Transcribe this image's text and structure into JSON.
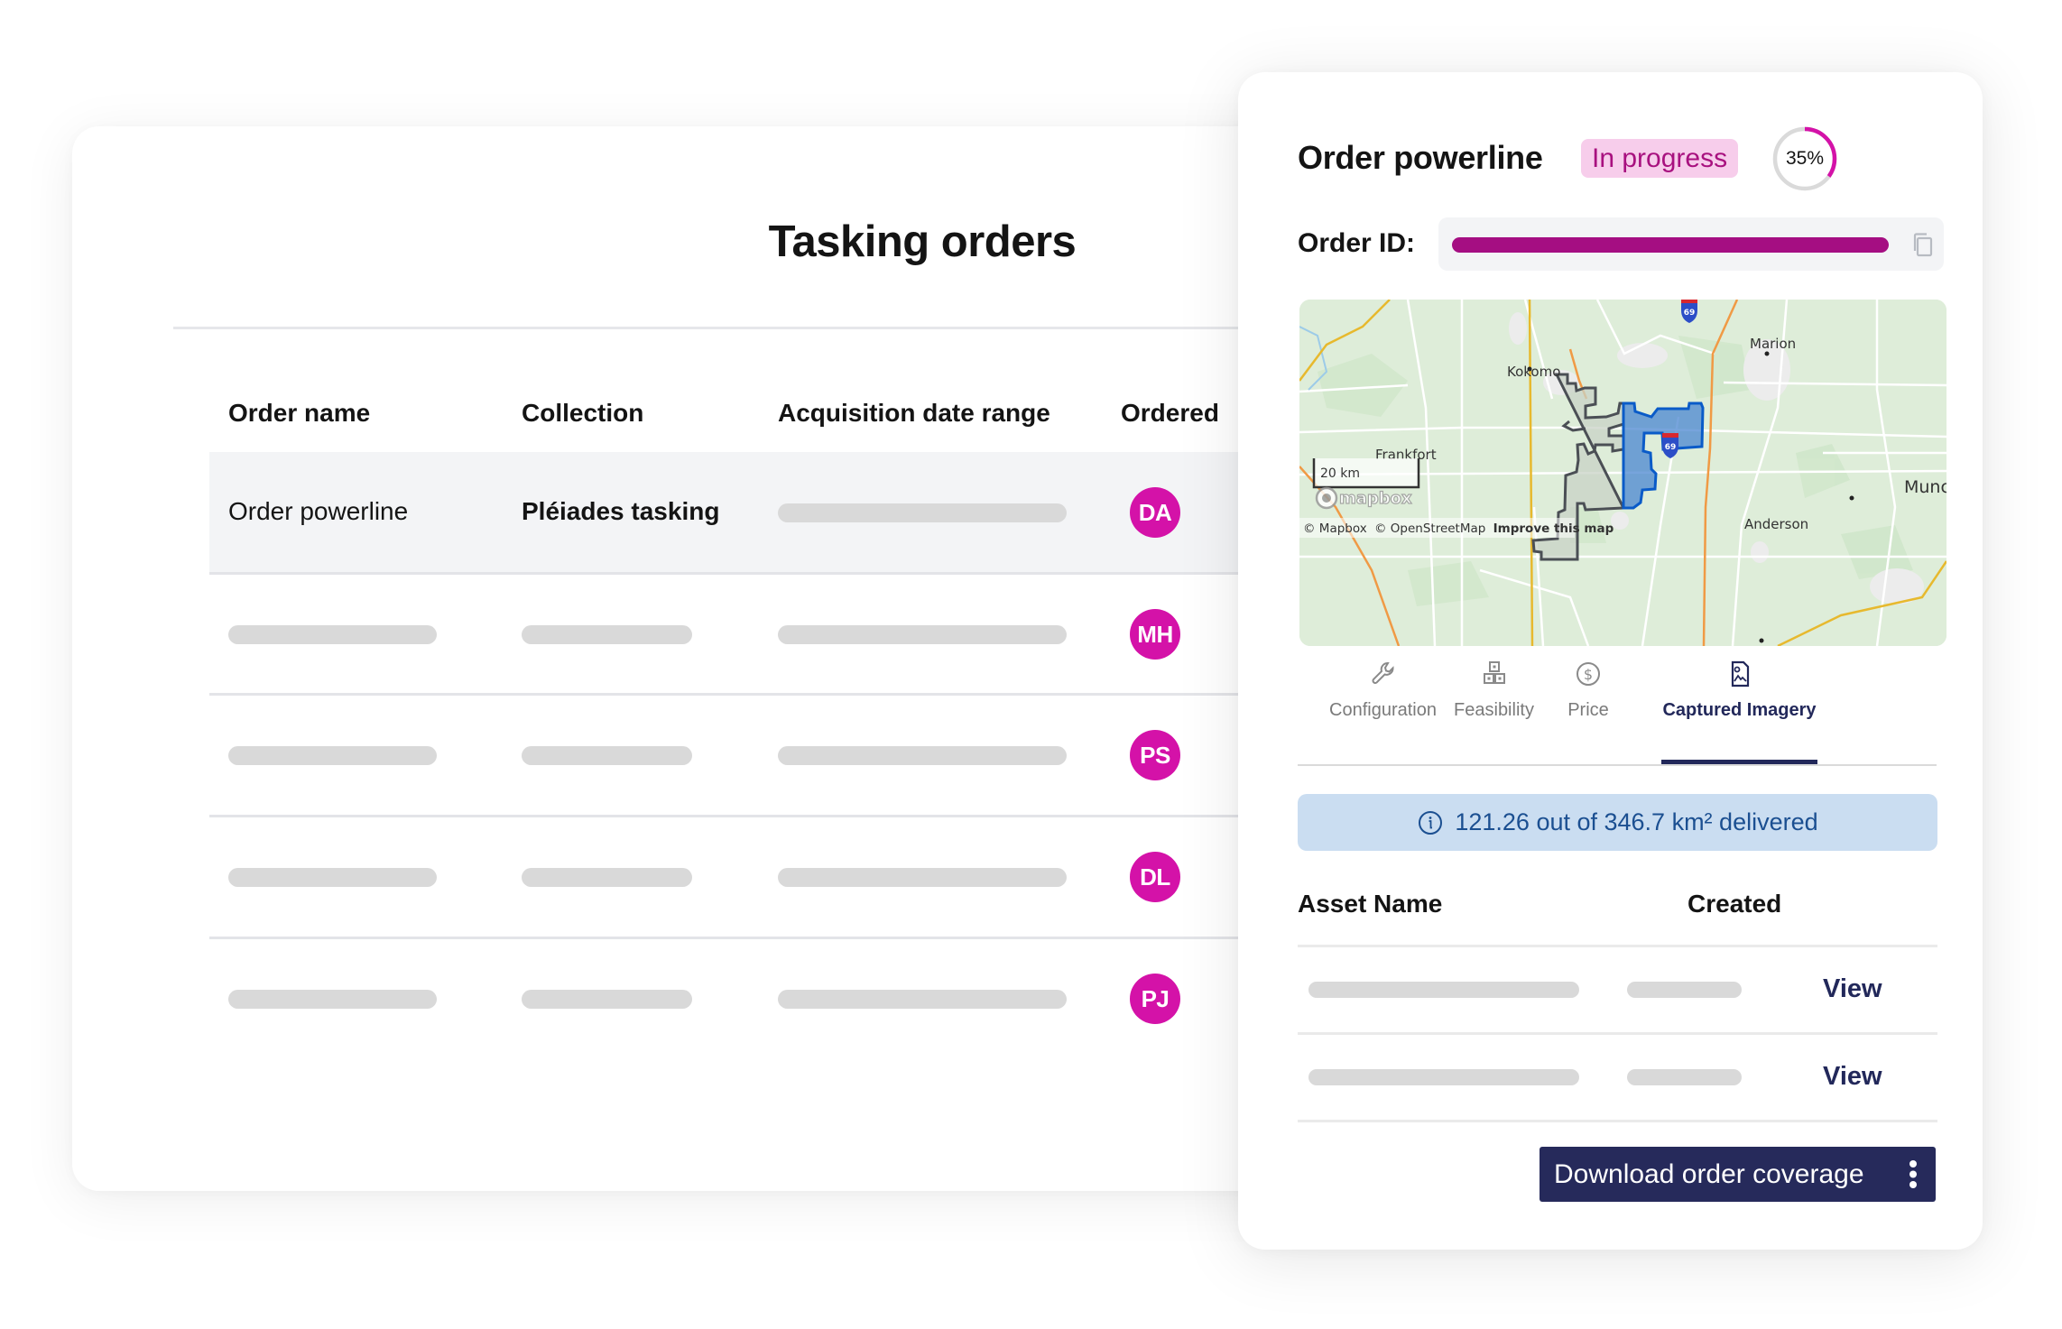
{
  "tasking_orders": {
    "title": "Tasking orders",
    "columns": [
      "Order name",
      "Collection",
      "Acquisition date range",
      "Ordered"
    ],
    "rows": [
      {
        "order_name": "Order powerline",
        "collection": "Pléiades tasking",
        "date_range": null,
        "ordered_by": "DA",
        "highlighted": true
      },
      {
        "order_name": null,
        "collection": null,
        "date_range": null,
        "ordered_by": "MH",
        "highlighted": false
      },
      {
        "order_name": null,
        "collection": null,
        "date_range": null,
        "ordered_by": "PS",
        "highlighted": false
      },
      {
        "order_name": null,
        "collection": null,
        "date_range": null,
        "ordered_by": "DL",
        "highlighted": false
      },
      {
        "order_name": null,
        "collection": null,
        "date_range": null,
        "ordered_by": "PJ",
        "highlighted": false
      }
    ]
  },
  "order_detail": {
    "title": "Order powerline",
    "status": "In progress",
    "progress_percent": 35,
    "progress_label": "35%",
    "order_id_label": "Order ID:",
    "order_id_value": null,
    "map": {
      "labels": [
        "Marion",
        "Kokomo",
        "Frankfort",
        "Muncie",
        "Anderson"
      ],
      "highway_shields": [
        "69",
        "69"
      ],
      "scale": "20 km",
      "logo": "mapbox",
      "attribution": [
        "© Mapbox",
        "© OpenStreetMap",
        "Improve this map"
      ]
    },
    "tabs": [
      {
        "label": "Configuration",
        "icon": "wrench-icon",
        "active": false
      },
      {
        "label": "Feasibility",
        "icon": "boxes-icon",
        "active": false
      },
      {
        "label": "Price",
        "icon": "dollar-circle-icon",
        "active": false
      },
      {
        "label": "Captured Imagery",
        "icon": "image-file-icon",
        "active": true
      }
    ],
    "delivery_info": "121.26 out of 346.7 km² delivered",
    "delivered_km2": 121.26,
    "total_km2": 346.7,
    "asset_columns": [
      "Asset Name",
      "Created"
    ],
    "assets": [
      {
        "name": null,
        "created": null,
        "action": "View"
      },
      {
        "name": null,
        "created": null,
        "action": "View"
      }
    ],
    "download_button": "Download order coverage"
  },
  "colors": {
    "accent_magenta": "#D412A8",
    "order_id_bar": "#A50E82",
    "badge_bg": "#F7CDEB",
    "badge_text": "#A8117F",
    "navy": "#22285A",
    "info_bg": "#CADDF1",
    "info_text": "#1B4F91",
    "polygon_delivered": "#4A86D0",
    "polygon_ordered": "#4B4F55"
  }
}
